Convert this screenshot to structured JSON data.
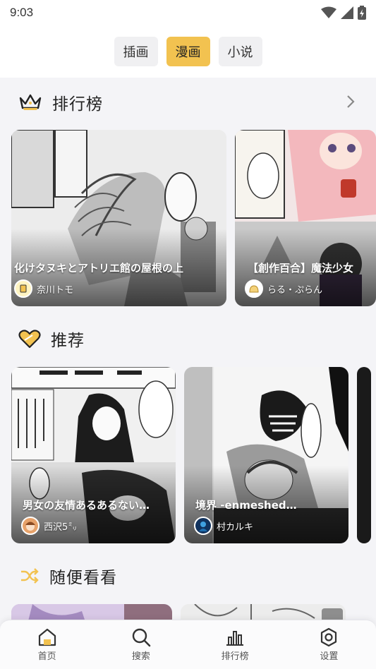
{
  "status_bar": {
    "time": "9:03"
  },
  "top_tabs": [
    {
      "label": "插画",
      "active": false
    },
    {
      "label": "漫画",
      "active": true
    },
    {
      "label": "小说",
      "active": false
    }
  ],
  "ranking": {
    "title": "排行榜",
    "cards": [
      {
        "title": "化けタヌキとアトリエ館の屋根の上",
        "author": "奈川トモ"
      },
      {
        "title": "【創作百合】魔法少女",
        "author": "らる・ぷらん"
      }
    ]
  },
  "recommend": {
    "title": "推荐",
    "cards": [
      {
        "title": "男女の友情あるあるない…",
        "author": "西沢5㍉"
      },
      {
        "title": "境界 -enmeshed…",
        "author": "村カルキ"
      }
    ]
  },
  "random": {
    "title": "随便看看"
  },
  "bottom_nav": [
    {
      "label": "首页",
      "icon": "home-icon"
    },
    {
      "label": "搜索",
      "icon": "search-icon"
    },
    {
      "label": "排行榜",
      "icon": "ranking-icon"
    },
    {
      "label": "设置",
      "icon": "settings-icon"
    }
  ],
  "colors": {
    "accent": "#f2c250",
    "background": "#f4f4f7"
  }
}
